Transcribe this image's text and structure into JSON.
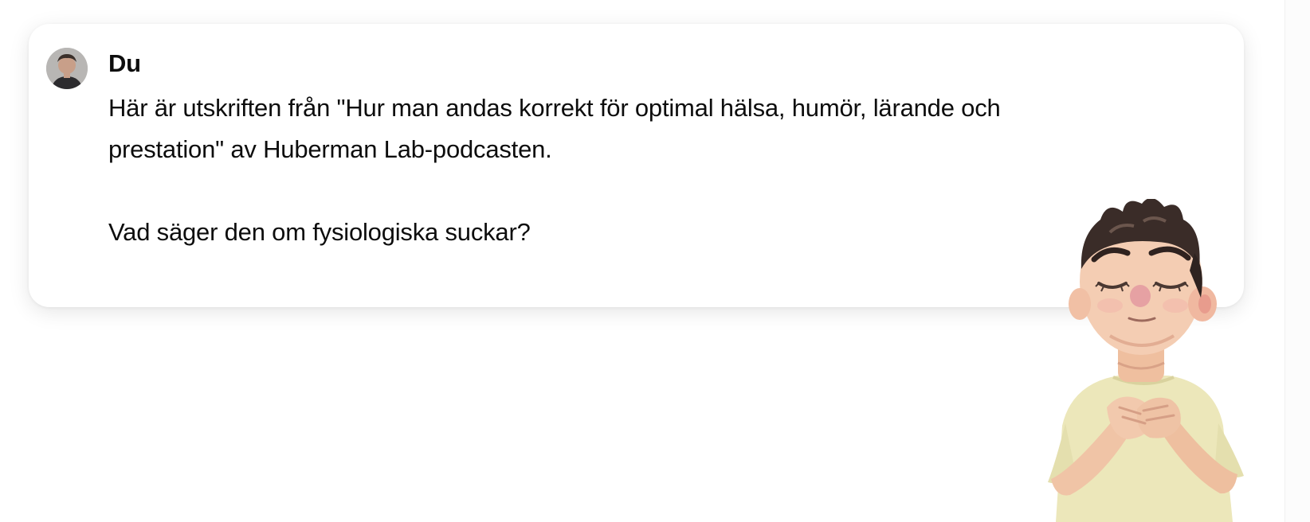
{
  "message": {
    "sender": "Du",
    "avatar_icon": "user-avatar",
    "line1": "Här är utskriften från \"Hur man andas korrekt för optimal hälsa, humör, lärande och",
    "line2": "prestation\" av Huberman Lab-podcasten.",
    "line3": "Vad säger den om fysiologiska suckar?"
  },
  "illustration": {
    "subject": "breathing-character",
    "colors": {
      "skin": "#f1c5a8",
      "hair": "#3a2c28",
      "shirt": "#ece7ba",
      "nose": "#e6a1a3"
    }
  }
}
